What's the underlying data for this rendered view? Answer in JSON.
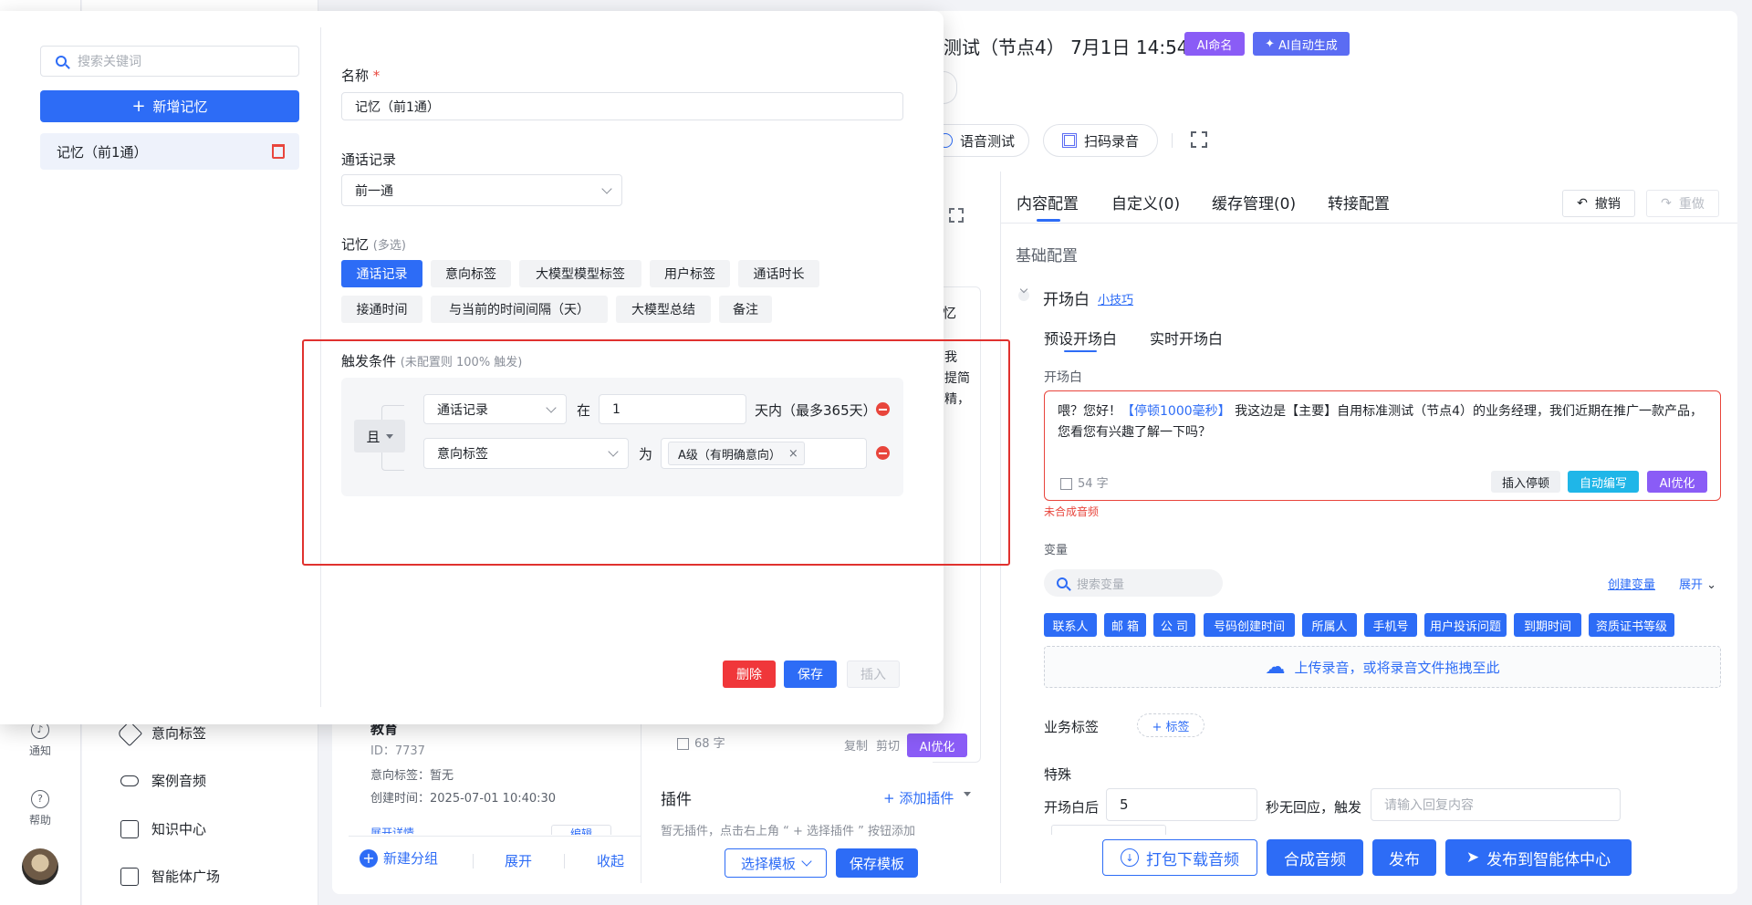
{
  "left_rail": {
    "notify": "通知",
    "help": "帮助"
  },
  "side_nav": [
    {
      "label": "意向标签"
    },
    {
      "label": "案例音频"
    },
    {
      "label": "知识中心"
    },
    {
      "label": "智能体广场"
    }
  ],
  "header": {
    "title": "测试（节点4） 7月1日 14:54",
    "ai_name": "AI命名",
    "ai_gen": "AI自动生成",
    "voice_test": "语音测试",
    "scan_record": "扫码录音"
  },
  "modal": {
    "search_placeholder": "搜索关键词",
    "add_memory": "新增记忆",
    "memory_item": "记忆（前1通）",
    "name_label": "名称",
    "name_required": "*",
    "name_value": "记忆（前1通）",
    "call_record_label": "通话记录",
    "call_record_value": "前一通",
    "memory_label": "记忆",
    "memory_hint": "(多选)",
    "memory_chips": [
      "通话记录",
      "意向标签",
      "大模型模型标签",
      "用户标签",
      "通话时长",
      "接通时间",
      "与当前的时间间隔（天）",
      "大模型总结",
      "备注"
    ],
    "trigger_label": "触发条件",
    "trigger_hint": "(未配置则 100% 触发)",
    "and_label": "且",
    "cond1_field": "通话记录",
    "cond1_op": "在",
    "cond1_value": "1",
    "cond1_unit": "天内（最多365天）",
    "cond2_field": "意向标签",
    "cond2_op": "为",
    "cond2_tag": "A级（有明确意向）",
    "delete": "删除",
    "save": "保存",
    "insert": "插入"
  },
  "middle": {
    "peek_text_1": "忆",
    "peek_text_2": "我",
    "peek_text_3": "提简",
    "peek_text_4": "精，",
    "char_count": "68 字",
    "copy": "复制",
    "cut": "剪切",
    "ai_opt": "AI优化",
    "plugin_title": "插件",
    "add_plugin": "+ 添加插件",
    "plugin_empty": "暂无插件，点击右上角 “ + 选择插件 ” 按钮添加",
    "choose_template": "选择模板",
    "save_template": "保存模板",
    "card_title": "教育",
    "card_id": "ID：7737",
    "card_intent": "意向标签：暂无",
    "card_created": "创建时间：2025-07-01 10:40:30",
    "card_more": "展开详情",
    "card_edit": "编辑",
    "new_group": "新建分组",
    "expand": "展开",
    "collapse": "收起"
  },
  "right": {
    "tabs": [
      "内容配置",
      "自定义(0)",
      "缓存管理(0)",
      "转接配置"
    ],
    "undo": "撤销",
    "redo": "重做",
    "basic_config": "基础配置",
    "opening_title": "开场白",
    "tips_link": "小技巧",
    "sub_tabs": [
      "预设开场白",
      "实时开场白"
    ],
    "opening_label": "开场白",
    "opening_text_pre": "喂？您好！",
    "opening_pause": "【停顿1000毫秒】",
    "opening_text_post": " 我这边是【主要】自用标准测试（节点4）的业务经理，我们近期在推广一款产品，您看您有兴趣了解一下吗？",
    "opening_count": "54 字",
    "insert_pause": "插入停顿",
    "auto_write": "自动编写",
    "ai_optimize": "AI优化",
    "not_synth": "未合成音频",
    "variables_label": "变量",
    "var_search_placeholder": "搜索变量",
    "create_var": "创建变量",
    "expand": "展开",
    "variables": [
      "联系人",
      "邮 箱",
      "公 司",
      "号码创建时间",
      "所属人",
      "手机号",
      "用户投诉问题",
      "到期时间",
      "资质证书等级"
    ],
    "upload_text": "上传录音，或将录音文件拖拽至此",
    "biz_tags_label": "业务标签",
    "add_tag": "+ 标签",
    "special_label": "特殊",
    "after_opening": "开场白后",
    "seconds_value": "5",
    "no_reply": "秒无回应，触发",
    "reply_placeholder": "请输入回复内容"
  },
  "bottom_bar": {
    "download": "打包下载音频",
    "synth": "合成音频",
    "publish": "发布",
    "publish_center": "发布到智能体中心"
  },
  "colors": {
    "primary": "#2d6cf6",
    "danger": "#e8453c",
    "purple": "#8a5cf6",
    "cyan": "#1fb6e8"
  }
}
